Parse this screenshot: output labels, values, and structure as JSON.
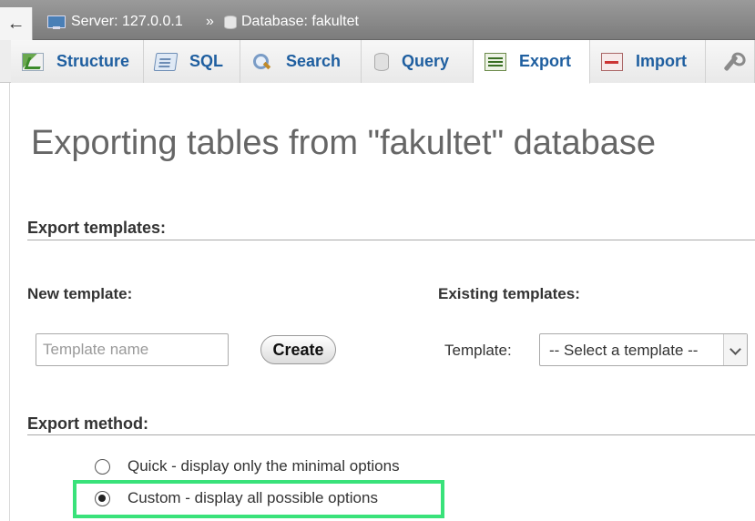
{
  "breadcrumb": {
    "back_glyph": "←",
    "server": "Server: 127.0.0.1",
    "separator": "»",
    "database": "Database: fakultet"
  },
  "tabs": [
    {
      "label": "Structure",
      "icon": "structure-icon"
    },
    {
      "label": "SQL",
      "icon": "sql-icon"
    },
    {
      "label": "Search",
      "icon": "search-icon"
    },
    {
      "label": "Query",
      "icon": "query-icon"
    },
    {
      "label": "Export",
      "icon": "export-icon",
      "active": true
    },
    {
      "label": "Import",
      "icon": "import-icon"
    },
    {
      "label": "",
      "icon": "wrench-icon"
    }
  ],
  "page": {
    "title": "Exporting tables from \"fakultet\" database"
  },
  "templates": {
    "heading": "Export templates:",
    "new_heading": "New template:",
    "existing_heading": "Existing templates:",
    "name_placeholder": "Template name",
    "create_label": "Create",
    "template_label": "Template:",
    "select_value": "-- Select a template --"
  },
  "method": {
    "heading": "Export method:",
    "options": [
      {
        "label": "Quick - display only the minimal options",
        "checked": false
      },
      {
        "label": "Custom - display all possible options",
        "checked": true
      }
    ]
  },
  "colors": {
    "highlight": "#39e27a",
    "tab_text": "#1f5fa0"
  }
}
